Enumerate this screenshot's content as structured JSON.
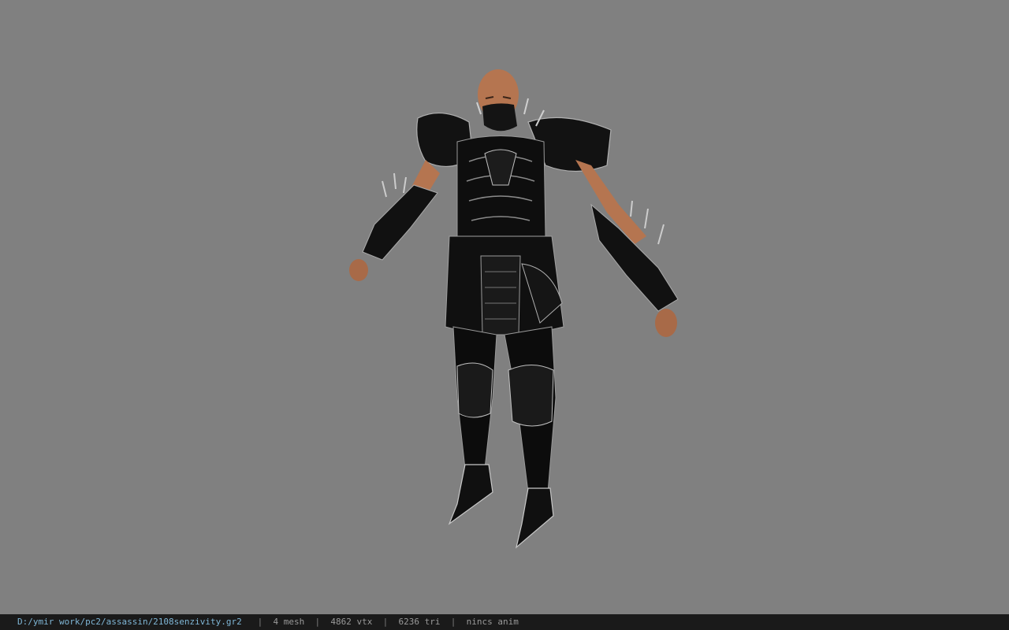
{
  "viewer": {
    "background_color": "#808080"
  },
  "model": {
    "name": "assassin-character-model"
  },
  "statusbar": {
    "file_path": "D:/ymir work/pc2/assassin/2108senzivity.gr2",
    "mesh_count": "4 mesh",
    "vertex_count": "4862 vtx",
    "triangle_count": "6236 tri",
    "animation": "nincs anim",
    "separator": "|"
  }
}
